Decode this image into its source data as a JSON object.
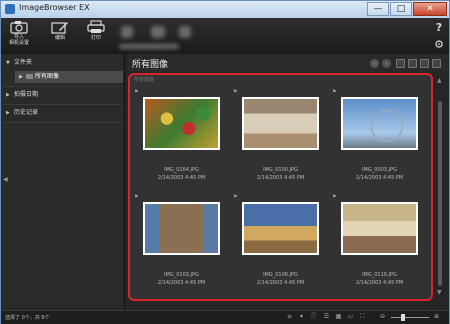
{
  "window": {
    "title": "ImageBrowser EX",
    "min_glyph": "—",
    "max_glyph": "□",
    "close_glyph": "✕"
  },
  "toolbar": {
    "import_label": "导入\n相机设置",
    "edit_label": "编辑",
    "print_label": "打印",
    "help_glyph": "?",
    "settings_glyph": "⚙"
  },
  "sidebar": {
    "folders_label": "文件夹",
    "all_images_label": "所有图像",
    "by_date_label": "拍摄日期",
    "history_label": "历史记录"
  },
  "main": {
    "title": "所有图像",
    "group_label": "所有图像",
    "thumbnails": [
      {
        "name": "IMG_0164.JPG",
        "date": "2/14/2003 4:45 PM"
      },
      {
        "name": "IMG_0100.JPG",
        "date": "2/14/2003 4:45 PM"
      },
      {
        "name": "IMG_0003.JPG",
        "date": "2/14/2003 4:45 PM"
      },
      {
        "name": "IMG_0103.JPG",
        "date": "2/14/2003 4:45 PM"
      },
      {
        "name": "IMG_0106.JPG",
        "date": "2/14/2003 4:45 PM"
      },
      {
        "name": "IMG_0110.JPG",
        "date": "2/14/2003 4:45 PM"
      }
    ]
  },
  "status": {
    "text": "选择了 0个，共 6个"
  },
  "colors": {
    "highlight_border": "#d8252d",
    "titlebar": "#c6d8ec",
    "background": "#262626"
  }
}
